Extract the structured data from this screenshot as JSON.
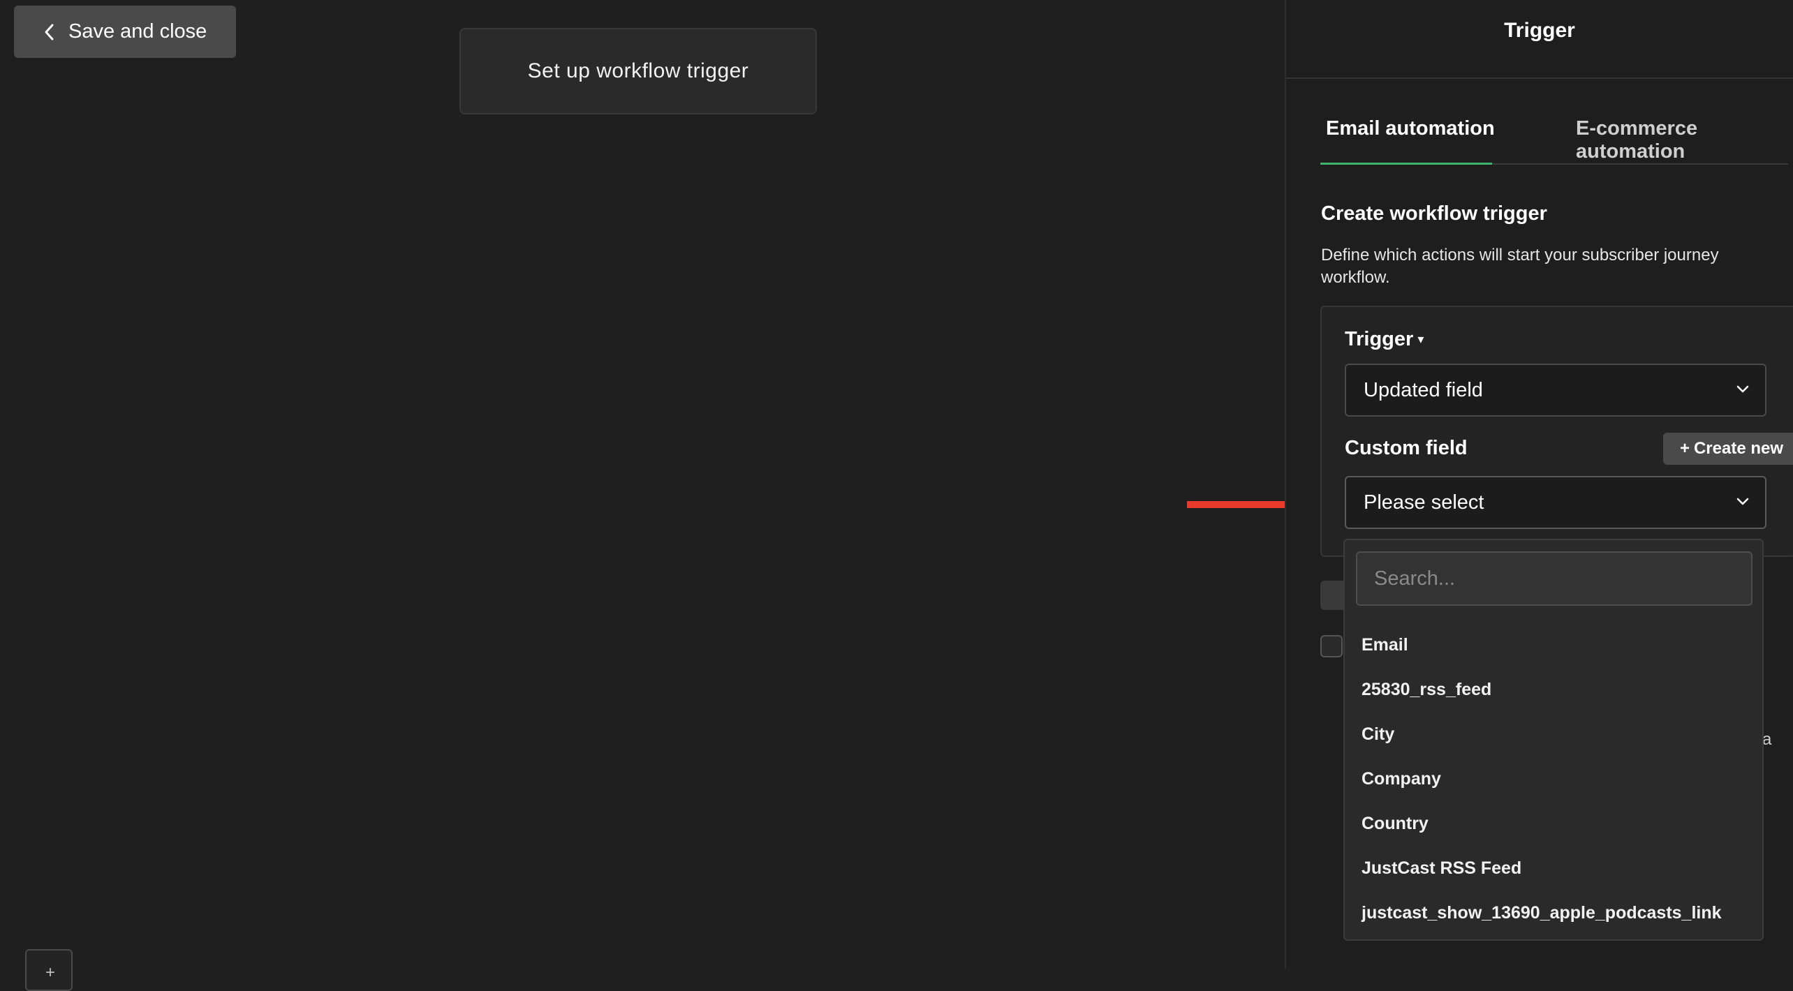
{
  "toolbar": {
    "save_close_label": "Save and close"
  },
  "canvas": {
    "trigger_node_label": "Set up workflow trigger",
    "add_node_label": "+"
  },
  "panel": {
    "title": "Trigger",
    "tabs": [
      {
        "label": "Email automation",
        "active": true
      },
      {
        "label": "E-commerce automation",
        "active": false
      }
    ],
    "section_title": "Create workflow trigger",
    "section_description": "Define which actions will start your subscriber journey workflow.",
    "trigger_label": "Trigger",
    "trigger_value": "Updated field",
    "custom_field_label": "Custom field",
    "create_new_label": "Create new",
    "custom_field_value": "Please select",
    "partial_text": "a"
  },
  "dropdown": {
    "search_placeholder": "Search...",
    "options": [
      "Email",
      "25830_rss_feed",
      "City",
      "Company",
      "Country",
      "JustCast RSS Feed",
      "justcast_show_13690_apple_podcasts_link"
    ]
  },
  "colors": {
    "background": "#1f1f1f",
    "panel": "#1e1e1e",
    "accent_tab": "#3fb36b",
    "annotation_arrow": "#e8392b"
  },
  "icons": [
    "chevron-left-icon",
    "chevron-down-icon",
    "plus-icon",
    "red-arrow-annotation"
  ]
}
